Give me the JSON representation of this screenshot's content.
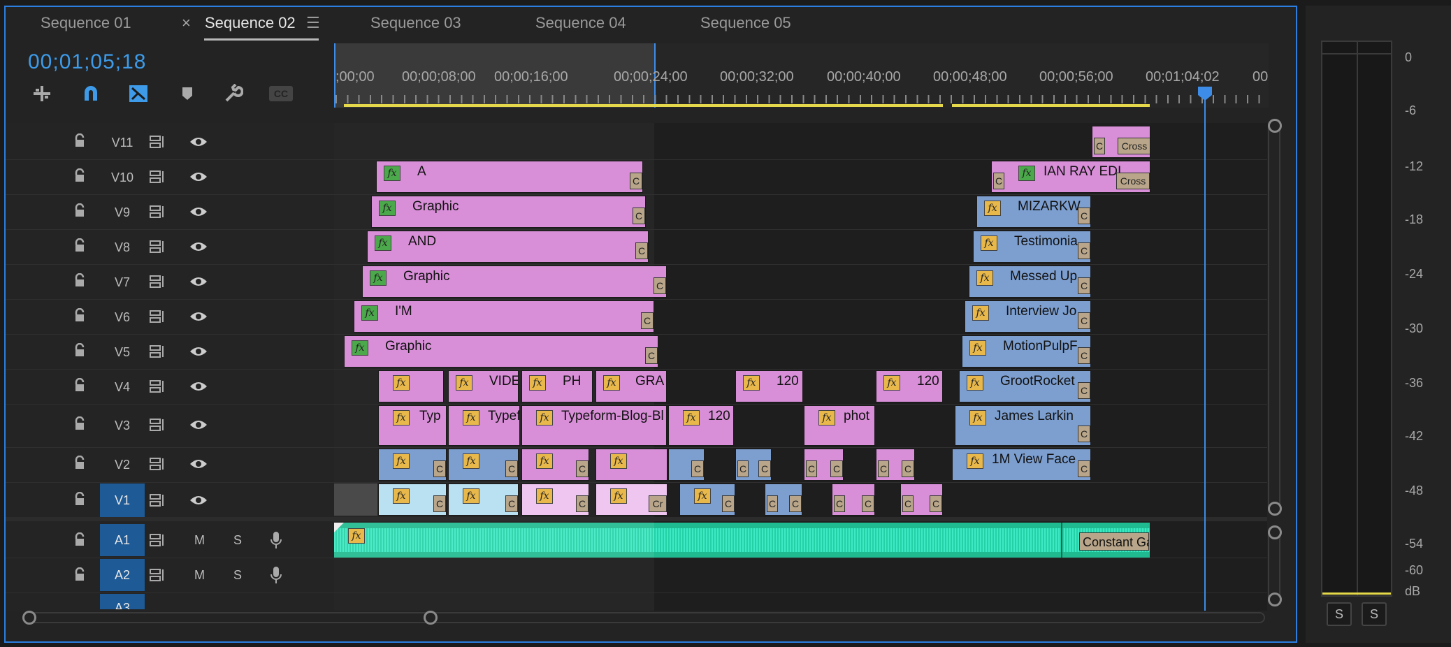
{
  "tabs": [
    "Sequence 01",
    "Sequence 02",
    "Sequence 03",
    "Sequence 04",
    "Sequence 05"
  ],
  "active_tab": "Sequence 02",
  "timecode": "00;01;05;18",
  "ruler_labels": [
    ";00;00",
    "00;00;08;00",
    "00;00;16;00",
    "00;00;24;00",
    "00;00;32;00",
    "00;00;40;00",
    "00;00;48;00",
    "00;00;56;00",
    "00;01;04;02",
    "00"
  ],
  "tools": [
    "insert-edit-icon",
    "snap-magnet-icon",
    "linked-selection-icon",
    "marker-icon",
    "wrench-icon",
    "captions-icon"
  ],
  "captions_label": "CC",
  "video_tracks": [
    "V11",
    "V10",
    "V9",
    "V8",
    "V7",
    "V6",
    "V5",
    "V4",
    "V3",
    "V2",
    "V1"
  ],
  "audio_tracks": [
    "A1",
    "A2",
    "A3"
  ],
  "audio_buttons": {
    "mute": "M",
    "solo": "S"
  },
  "clip_labels": {
    "v11_a": "C",
    "v11_b": "Cross",
    "v10_a": "A",
    "v10_b": "IAN RAY EDI",
    "v10_c": "Cross",
    "v10_d": "C",
    "v9_a": "Graphic",
    "v9_b": "MIZARKW",
    "v8_a": "AND",
    "v8_b": "Testimonia",
    "v7_a": "Graphic",
    "v7_b": "Messed Up",
    "v6_a": "I'M",
    "v6_b": "Interview Jo",
    "v5_a": "Graphic",
    "v5_b": "MotionPulpF",
    "v4_b": "VIDE",
    "v4_c": "PH",
    "v4_d": "GRA",
    "v4_e": "120",
    "v4_f": "120",
    "v4_g": "GrootRocket",
    "v3_a": "Typ",
    "v3_b": "Typef",
    "v3_c": "Typeform-Blog-Bl",
    "v3_d": "120",
    "v3_e": "phot",
    "v3_f": "James Larkin",
    "v2_a": "1M View Face",
    "v1_cr": "Cr",
    "a1": "Constant Ga",
    "fx": "fx",
    "c": "C"
  },
  "meter_scale": [
    "0",
    "-6",
    "-12",
    "-18",
    "-24",
    "-30",
    "-36",
    "-42",
    "-48",
    "-54",
    "-60",
    "dB"
  ],
  "meter_buttons": [
    "S",
    "S"
  ],
  "colors": {
    "accent": "#3d9be9",
    "video_clip": "#d88fd8",
    "nested_clip": "#7d9fd0",
    "audio_clip": "#1fba8f",
    "work_area": "#e5d84a"
  }
}
